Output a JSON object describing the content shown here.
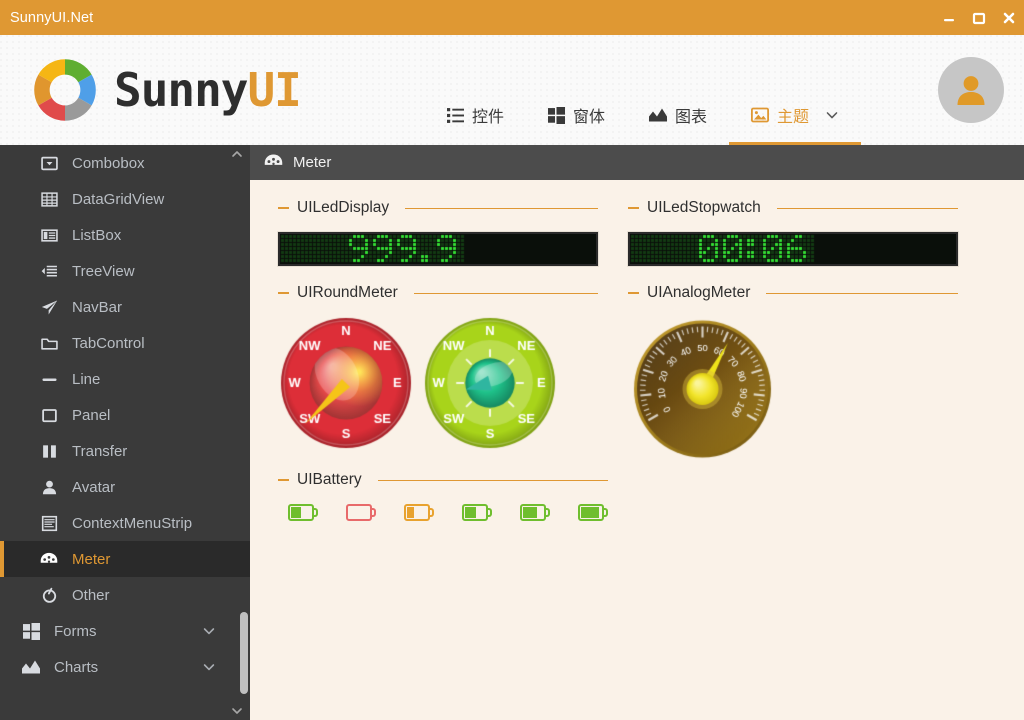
{
  "window": {
    "title": "SunnyUI.Net",
    "controls": [
      {
        "name": "minimize",
        "glyph": "minimize-icon"
      },
      {
        "name": "maximize",
        "glyph": "maximize-icon"
      },
      {
        "name": "close",
        "glyph": "close-icon"
      }
    ],
    "titlebar_color": "#DF9833"
  },
  "brand": {
    "name_dark": "Sunny",
    "name_accent": "UI",
    "logo_icon": "sunny-donut-logo",
    "wheel_colors": [
      "#F5B614",
      "#5FAE31",
      "#4F9FE8",
      "#9A9A9A",
      "#E04B4B",
      "#E0962E"
    ]
  },
  "nav": {
    "items": [
      {
        "label": "控件",
        "icon": "list-icon",
        "active": false
      },
      {
        "label": "窗体",
        "icon": "windows-icon",
        "active": false
      },
      {
        "label": "图表",
        "icon": "chart-icon",
        "active": false
      },
      {
        "label": "主题",
        "icon": "image-icon",
        "active": true,
        "chevron": "chevron-down-icon"
      }
    ],
    "accent_color": "#DF9833"
  },
  "avatar": {
    "icon": "user-icon",
    "bg": "#C6C6C6",
    "fg": "#E09A28"
  },
  "sidebar": {
    "bg": "#3A3A3A",
    "selected_bg": "#2A2A2A",
    "selected_color": "#DF9833",
    "items": [
      {
        "label": "Combobox",
        "icon": "combobox-icon",
        "level": "sub",
        "selected": false
      },
      {
        "label": "DataGridView",
        "icon": "grid-icon",
        "level": "sub",
        "selected": false
      },
      {
        "label": "ListBox",
        "icon": "listbox-icon",
        "level": "sub",
        "selected": false
      },
      {
        "label": "TreeView",
        "icon": "treeview-icon",
        "level": "sub",
        "selected": false
      },
      {
        "label": "NavBar",
        "icon": "paper-plane-icon",
        "level": "sub",
        "selected": false
      },
      {
        "label": "TabControl",
        "icon": "folder-icon",
        "level": "sub",
        "selected": false
      },
      {
        "label": "Line",
        "icon": "line-icon",
        "level": "sub",
        "selected": false
      },
      {
        "label": "Panel",
        "icon": "square-icon",
        "level": "sub",
        "selected": false
      },
      {
        "label": "Transfer",
        "icon": "transfer-icon",
        "level": "sub",
        "selected": false
      },
      {
        "label": "Avatar",
        "icon": "person-icon",
        "level": "sub",
        "selected": false
      },
      {
        "label": "ContextMenuStrip",
        "icon": "menu-strip-icon",
        "level": "sub",
        "selected": false
      },
      {
        "label": "Meter",
        "icon": "meter-icon",
        "level": "sub",
        "selected": true
      },
      {
        "label": "Other",
        "icon": "circle-slash-icon",
        "level": "sub",
        "selected": false
      },
      {
        "label": "Forms",
        "icon": "windows-icon",
        "level": "top",
        "selected": false,
        "chevron": "chevron-down-icon"
      },
      {
        "label": "Charts",
        "icon": "chart-icon",
        "level": "top",
        "selected": false,
        "chevron": "chevron-down-icon"
      }
    ],
    "scrollbar": {
      "up": "chevron-up-icon",
      "down": "chevron-down-icon",
      "thumb": "scroll-thumb"
    }
  },
  "content": {
    "header": {
      "icon": "meter-icon",
      "title": "Meter"
    },
    "groups": [
      {
        "id": "led-display",
        "title": "UILedDisplay"
      },
      {
        "id": "led-stopwatch",
        "title": "UILedStopwatch"
      },
      {
        "id": "round-meter",
        "title": "UIRoundMeter"
      },
      {
        "id": "analog-meter",
        "title": "UIAnalogMeter"
      },
      {
        "id": "battery",
        "title": "UIBattery"
      }
    ],
    "led_display": {
      "value": "999.9",
      "on_color": "#33DD33",
      "off_color": "#123A12",
      "bg": "#0A0F0A"
    },
    "led_stopwatch": {
      "value": "00:06",
      "on_color": "#33DD33",
      "off_color": "#123A12",
      "bg": "#0A0F0A"
    },
    "round_meters": [
      {
        "id": "round-meter-red",
        "face_color": "#DD2E38",
        "inner_color": "#E84A4A",
        "needle_color": "#F5C518",
        "labels": [
          "N",
          "NE",
          "E",
          "SE",
          "S",
          "SW",
          "W",
          "NW"
        ],
        "direction": "SW",
        "angle_deg": 225,
        "ticks": false
      },
      {
        "id": "round-meter-green",
        "face_color": "#A8D41A",
        "inner_color": "#1FC28A",
        "needle_color": "#2FB6A0",
        "labels": [
          "N",
          "NE",
          "E",
          "SE",
          "S",
          "SW",
          "W",
          "NW"
        ],
        "direction": "W",
        "angle_deg": 255,
        "ticks": true
      }
    ],
    "analog_meter": {
      "id": "analog-meter-gauge",
      "value": 62,
      "min": 0,
      "max": 100,
      "tick_labels": [
        "0",
        "10",
        "20",
        "30",
        "40",
        "50",
        "60",
        "70",
        "80",
        "90",
        "100"
      ],
      "needle_color": "#EFE21A",
      "face_outer": "#8A6A14",
      "face_inner": "#4A3008",
      "hub_color": "#F2E52B"
    },
    "batteries": [
      {
        "percent": 50,
        "color": "#6FBE2E"
      },
      {
        "percent": 0,
        "color": "#E86A6A"
      },
      {
        "percent": 35,
        "color": "#E8A22E"
      },
      {
        "percent": 55,
        "color": "#6FBE2E"
      },
      {
        "percent": 72,
        "color": "#6FBE2E"
      },
      {
        "percent": 92,
        "color": "#6FBE2E"
      }
    ]
  }
}
